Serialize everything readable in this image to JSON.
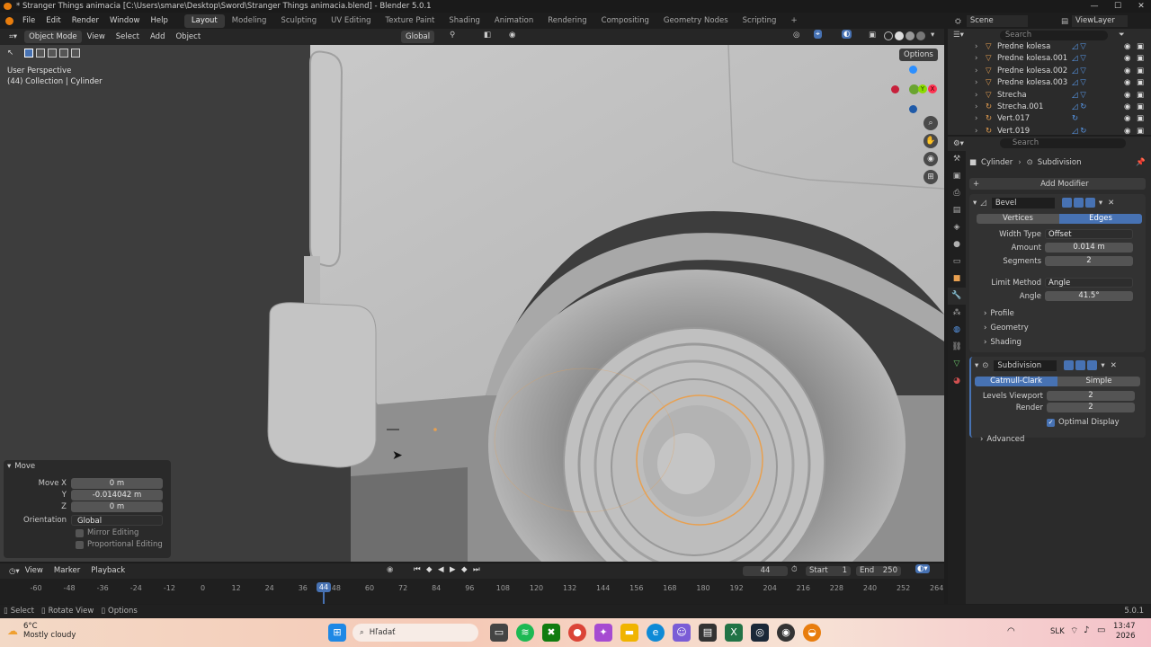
{
  "window": {
    "title": "* Stranger Things animacia [C:\\Users\\smare\\Desktop\\Sword\\Stranger Things animacia.blend] - Blender 5.0.1",
    "minimize": "—",
    "maximize": "☐",
    "close": "✕"
  },
  "menu": {
    "file": "File",
    "edit": "Edit",
    "render": "Render",
    "window": "Window",
    "help": "Help"
  },
  "workspaces": [
    "Layout",
    "Modeling",
    "Sculpting",
    "UV Editing",
    "Texture Paint",
    "Shading",
    "Animation",
    "Rendering",
    "Compositing",
    "Geometry Nodes",
    "Scripting"
  ],
  "add_workspace": "+",
  "scene": {
    "label": "Scene",
    "view_layer": "ViewLayer"
  },
  "viewport": {
    "mode": "Object Mode",
    "menus": [
      "View",
      "Select",
      "Add",
      "Object"
    ],
    "transform_orientation": "Global",
    "options": "Options",
    "overlay_title": "User Perspective",
    "overlay_sub": "(44) Collection | Cylinder",
    "gizmo": {
      "x": "X",
      "y": "Y",
      "z": "Z"
    }
  },
  "operator_panel": {
    "title": "Move",
    "move_x_label": "Move X",
    "move_x": "0 m",
    "y_label": "Y",
    "y": "-0.014042 m",
    "z_label": "Z",
    "z": "0 m",
    "orientation_label": "Orientation",
    "orientation": "Global",
    "mirror_editing": "Mirror Editing",
    "proportional_editing": "Proportional Editing"
  },
  "outliner": {
    "search_placeholder": "Search",
    "items": [
      {
        "name": "Predne kolesa"
      },
      {
        "name": "Predne kolesa.001"
      },
      {
        "name": "Predne kolesa.002"
      },
      {
        "name": "Predne kolesa.003"
      },
      {
        "name": "Strecha"
      },
      {
        "name": "Strecha.001"
      },
      {
        "name": "Vert.017"
      },
      {
        "name": "Vert.019"
      }
    ]
  },
  "properties": {
    "search_placeholder": "Search",
    "breadcrumb_object": "Cylinder",
    "breadcrumb_modifier": "Subdivision",
    "add_modifier": "Add Modifier",
    "bevel": {
      "name": "Bevel",
      "affect_vertices": "Vertices",
      "affect_edges": "Edges",
      "width_type_label": "Width Type",
      "width_type": "Offset",
      "amount_label": "Amount",
      "amount": "0.014 m",
      "segments_label": "Segments",
      "segments": "2",
      "limit_method_label": "Limit Method",
      "limit_method": "Angle",
      "angle_label": "Angle",
      "angle": "41.5°",
      "profile": "Profile",
      "geometry": "Geometry",
      "shading": "Shading"
    },
    "subdivision": {
      "name": "Subdivision",
      "catmull_clark": "Catmull-Clark",
      "simple": "Simple",
      "levels_viewport_label": "Levels Viewport",
      "levels_viewport": "2",
      "render_label": "Render",
      "render": "2",
      "optimal_display": "Optimal Display",
      "advanced": "Advanced"
    }
  },
  "timeline": {
    "menus": [
      "View",
      "Marker",
      "Playback"
    ],
    "current_frame": "44",
    "start_label": "Start",
    "start": "1",
    "end_label": "End",
    "end": "250",
    "ticks": [
      "-60",
      "-48",
      "-36",
      "-24",
      "-12",
      "0",
      "12",
      "24",
      "36",
      "48",
      "60",
      "72",
      "84",
      "96",
      "108",
      "120",
      "132",
      "144",
      "156",
      "168",
      "180",
      "192",
      "204",
      "216",
      "228",
      "240",
      "252",
      "264"
    ],
    "playhead": "44"
  },
  "status_bar": {
    "select": "Select",
    "rotate_view": "Rotate View",
    "options": "Options",
    "version": "5.0.1"
  },
  "taskbar": {
    "weather_temp": "6°C",
    "weather_desc": "Mostly cloudy",
    "search_placeholder": "Hľadať",
    "language": "SLK",
    "time": "13:47",
    "date": "2026"
  },
  "colors": {
    "accent": "#4772b3",
    "selection": "#e8a050",
    "viewport_bg": "#3b3b3b"
  }
}
